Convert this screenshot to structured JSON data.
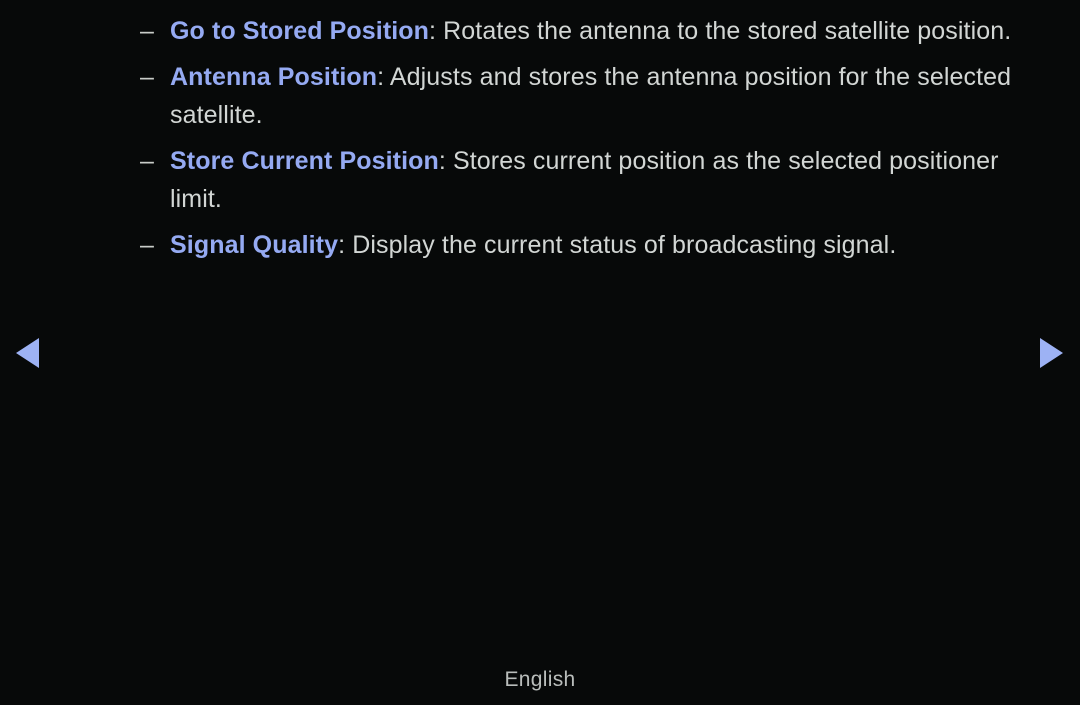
{
  "screen": {
    "background_color": "#070909",
    "body_text_color": "#d2d6d4",
    "term_color": "#95aaf2",
    "arrow_color": "#9db2f4"
  },
  "content": {
    "bullets": [
      {
        "dash": "–",
        "term": "Go to Stored Position",
        "separator": ": ",
        "description": "Rotates the antenna to the stored satellite position."
      },
      {
        "dash": "–",
        "term": "Antenna Position",
        "separator": ": ",
        "description": "Adjusts and stores the antenna position for the selected satellite."
      },
      {
        "dash": "–",
        "term": "Store Current Position",
        "separator": ": ",
        "description": "Stores current position as the selected positioner limit."
      },
      {
        "dash": "–",
        "term": "Signal Quality",
        "separator": ": ",
        "description": "Display the current status of broadcasting signal."
      }
    ]
  },
  "navigation": {
    "prev_label": "◀",
    "next_label": "▶"
  },
  "footer": {
    "language": "English"
  }
}
